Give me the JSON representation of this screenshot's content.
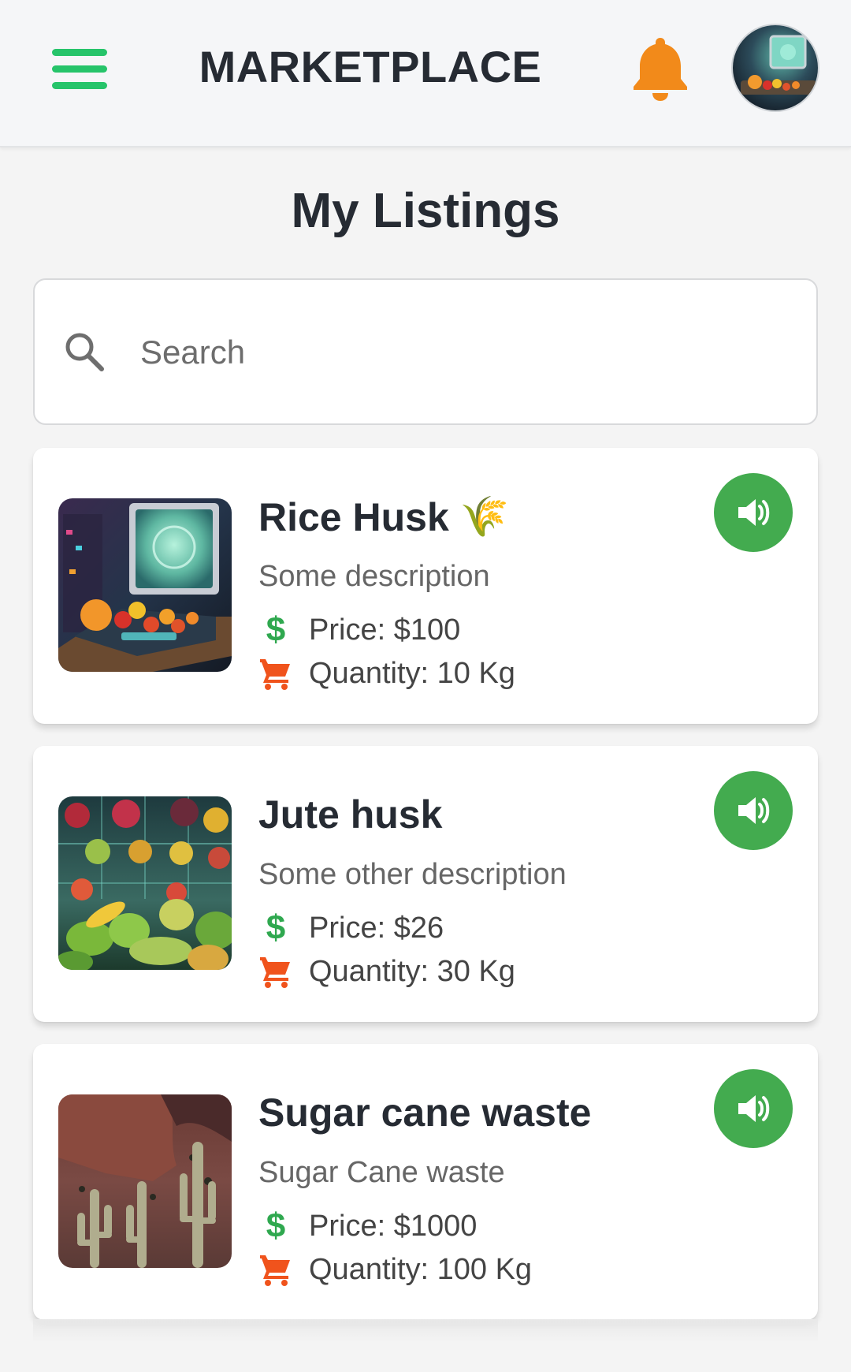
{
  "header": {
    "title": "MARKETPLACE",
    "menu_icon": "hamburger-menu-icon",
    "notification_icon": "bell-icon",
    "accent_color": "#26c46a",
    "bell_color": "#f28a1a"
  },
  "page": {
    "title": "My Listings"
  },
  "search": {
    "placeholder": "Search",
    "value": ""
  },
  "listings": [
    {
      "name": "Rice Husk",
      "name_emoji": "🌾",
      "description": "Some description",
      "price": "Price: $100",
      "quantity": "Quantity: 10 Kg"
    },
    {
      "name": "Jute husk",
      "name_emoji": "",
      "description": "Some other description",
      "price": "Price: $26",
      "quantity": "Quantity: 30 Kg"
    },
    {
      "name": "Sugar cane waste",
      "name_emoji": "",
      "description": "Sugar Cane waste",
      "price": "Price: $1000",
      "quantity": "Quantity: 100 Kg"
    }
  ],
  "icons": {
    "price": "$",
    "quantity": "cart-icon",
    "speak": "speaker-icon"
  },
  "colors": {
    "speak_button": "#43ab4f",
    "price_icon": "#2fa84f",
    "cart_icon": "#f0531c"
  }
}
